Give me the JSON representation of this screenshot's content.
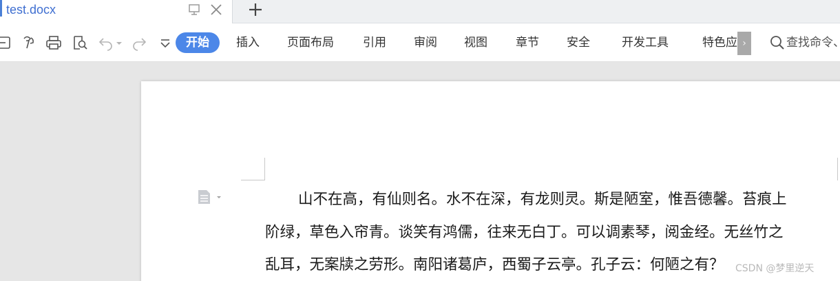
{
  "tab": {
    "title": "test.docx"
  },
  "toolbar": {
    "icons": [
      "save-icon",
      "format-painter-icon",
      "print-icon",
      "print-preview-icon",
      "undo-icon",
      "redo-icon",
      "customize-dropdown-icon"
    ],
    "menus": [
      "开始",
      "插入",
      "页面布局",
      "引用",
      "审阅",
      "视图",
      "章节",
      "安全",
      "开发工具",
      "特色应"
    ],
    "active_menu": "开始",
    "more_glyph": "›",
    "search_text": "查找命令、",
    "accent_color": "#4c87e8"
  },
  "document": {
    "lines": [
      "山不在高，有仙则名。水不在深，有龙则灵。斯是陋室，惟吾德馨。苔痕上",
      "阶绿，草色入帘青。谈笑有鸿儒，往来无白丁。可以调素琴，阅金经。无丝竹之",
      "乱耳，无案牍之劳形。南阳诸葛庐，西蜀子云亭。孔子云：何陋之有？"
    ]
  },
  "watermark": "CSDN @梦里逆天"
}
